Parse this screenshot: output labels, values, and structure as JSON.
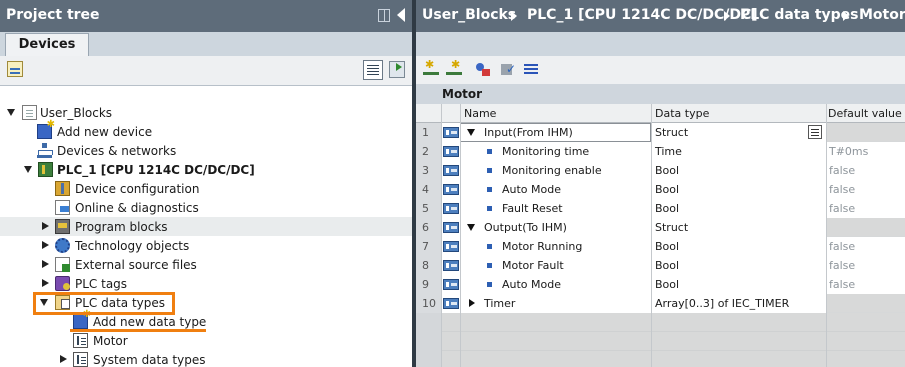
{
  "left_pane": {
    "title": "Project tree",
    "tab": "Devices",
    "tree": [
      {
        "label": "User_Blocks",
        "icon": "document-icon",
        "expanded": true,
        "bold": false
      },
      {
        "label": "Add new device",
        "icon": "add-device-icon",
        "bold": false
      },
      {
        "label": "Devices & networks",
        "icon": "network-icon",
        "bold": false
      },
      {
        "label": "PLC_1 [CPU 1214C DC/DC/DC]",
        "icon": "plc-icon",
        "expanded": true,
        "bold": true
      },
      {
        "label": "Device configuration",
        "icon": "device-config-icon",
        "bold": false
      },
      {
        "label": "Online & diagnostics",
        "icon": "online-diagnostics-icon",
        "bold": false
      },
      {
        "label": "Program blocks",
        "icon": "program-blocks-icon",
        "expanded": false,
        "bold": false
      },
      {
        "label": "Technology objects",
        "icon": "technology-objects-icon",
        "expanded": false,
        "bold": false
      },
      {
        "label": "External source files",
        "icon": "external-files-icon",
        "expanded": false,
        "bold": false
      },
      {
        "label": "PLC tags",
        "icon": "plc-tags-icon",
        "expanded": false,
        "bold": false
      },
      {
        "label": "PLC data types",
        "icon": "data-types-folder-icon",
        "expanded": true,
        "bold": false
      },
      {
        "label": "Add new data type",
        "icon": "add-data-type-icon",
        "bold": false
      },
      {
        "label": "Motor",
        "icon": "udt-icon",
        "bold": false
      },
      {
        "label": "System data types",
        "icon": "system-types-icon",
        "expanded": false,
        "bold": false
      }
    ]
  },
  "right_pane": {
    "breadcrumb": [
      "User_Blocks",
      "PLC_1 [CPU 1214C DC/DC/DC]",
      "PLC data types",
      "Motor"
    ],
    "type_title": "Motor",
    "columns": {
      "name": "Name",
      "data_type": "Data type",
      "default_value": "Default value"
    },
    "rows": [
      {
        "num": "1",
        "name": "Input(From IHM)",
        "type": "Struct",
        "default": "",
        "level": 0,
        "expander": "open"
      },
      {
        "num": "2",
        "name": "Monitoring time",
        "type": "Time",
        "default": "T#0ms",
        "level": 1
      },
      {
        "num": "3",
        "name": "Monitoring enable",
        "type": "Bool",
        "default": "false",
        "level": 1
      },
      {
        "num": "4",
        "name": "Auto Mode",
        "type": "Bool",
        "default": "false",
        "level": 1
      },
      {
        "num": "5",
        "name": "Fault Reset",
        "type": "Bool",
        "default": "false",
        "level": 1
      },
      {
        "num": "6",
        "name": "Output(To IHM)",
        "type": "Struct",
        "default": "",
        "level": 0,
        "expander": "open"
      },
      {
        "num": "7",
        "name": "Motor Running",
        "type": "Bool",
        "default": "false",
        "level": 1
      },
      {
        "num": "8",
        "name": "Motor Fault",
        "type": "Bool",
        "default": "false",
        "level": 1
      },
      {
        "num": "9",
        "name": "Auto Mode",
        "type": "Bool",
        "default": "false",
        "level": 1
      },
      {
        "num": "10",
        "name": "Timer",
        "type": "Array[0..3] of IEC_TIMER",
        "default": "",
        "level": 0,
        "expander": "closed"
      }
    ]
  },
  "colors": {
    "title_bar": "#5e6c7a",
    "highlight": "#f07f10",
    "bullet": "#2d5fb3"
  }
}
